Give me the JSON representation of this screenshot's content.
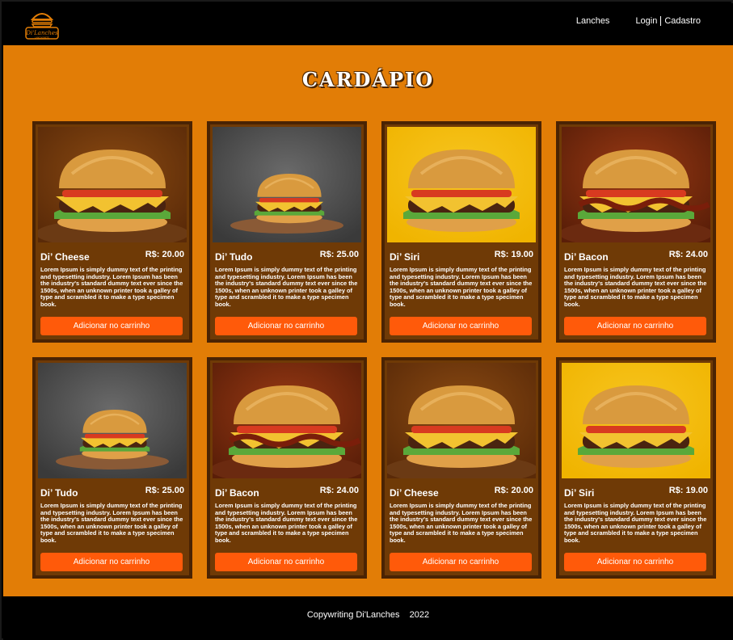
{
  "header": {
    "logo_text": "Di'Lanches",
    "logo_subtext": "LANCHONETE",
    "nav": {
      "lanches": "Lanches",
      "login": "Login",
      "cadastro": "Cadastro"
    }
  },
  "main": {
    "title": "CARDÁPIO",
    "button_label": "Adicionar no carrinho",
    "products": [
      {
        "name": "Di’ Cheese",
        "price": "R$: 20.00",
        "image": "cheese-burger",
        "description": "Lorem Ipsum is simply dummy text of the printing and typesetting industry. Lorem Ipsum has been the industry's standard dummy text ever since the 1500s, when an unknown printer took a galley of type and scrambled it to make a type specimen book."
      },
      {
        "name": "Di’ Tudo",
        "price": "R$: 25.00",
        "image": "tudo-burger",
        "description": "Lorem Ipsum is simply dummy text of the printing and typesetting industry. Lorem Ipsum has been the industry's standard dummy text ever since the 1500s, when an unknown printer took a galley of type and scrambled it to make a type specimen book."
      },
      {
        "name": "Di’ Siri",
        "price": "R$: 19.00",
        "image": "siri-burger",
        "description": "Lorem Ipsum is simply dummy text of the printing and typesetting industry. Lorem Ipsum has been the industry's standard dummy text ever since the 1500s, when an unknown printer took a galley of type and scrambled it to make a type specimen book."
      },
      {
        "name": "Di’ Bacon",
        "price": "R$: 24.00",
        "image": "bacon-burger",
        "description": "Lorem Ipsum is simply dummy text of the printing and typesetting industry. Lorem Ipsum has been the industry's standard dummy text ever since the 1500s, when an unknown printer took a galley of type and scrambled it to make a type specimen book."
      },
      {
        "name": "Di’ Tudo",
        "price": "R$: 25.00",
        "image": "tudo-burger",
        "description": "Lorem Ipsum is simply dummy text of the printing and typesetting industry. Lorem Ipsum has been the industry's standard dummy text ever since the 1500s, when an unknown printer took a galley of type and scrambled it to make a type specimen book."
      },
      {
        "name": "Di’ Bacon",
        "price": "R$: 24.00",
        "image": "bacon-burger",
        "description": "Lorem Ipsum is simply dummy text of the printing and typesetting industry. Lorem Ipsum has been the industry's standard dummy text ever since the 1500s, when an unknown printer took a galley of type and scrambled it to make a type specimen book."
      },
      {
        "name": "Di’ Cheese",
        "price": "R$: 20.00",
        "image": "cheese-burger",
        "description": "Lorem Ipsum is simply dummy text of the printing and typesetting industry. Lorem Ipsum has been the industry's standard dummy text ever since the 1500s, when an unknown printer took a galley of type and scrambled it to make a type specimen book."
      },
      {
        "name": "Di’ Siri",
        "price": "R$: 19.00",
        "image": "siri-burger",
        "description": "Lorem Ipsum is simply dummy text of the printing and typesetting industry. Lorem Ipsum has been the industry's standard dummy text ever since the 1500s, when an unknown printer took a galley of type and scrambled it to make a type specimen book."
      }
    ]
  },
  "footer": {
    "text": "Copywriting Di'Lanches    2022"
  },
  "colors": {
    "main_bg": "#e27d06",
    "card_bg": "#6f3a06",
    "card_border": "#4a2303",
    "button": "#ff5a0a",
    "header_bg": "#000000"
  }
}
